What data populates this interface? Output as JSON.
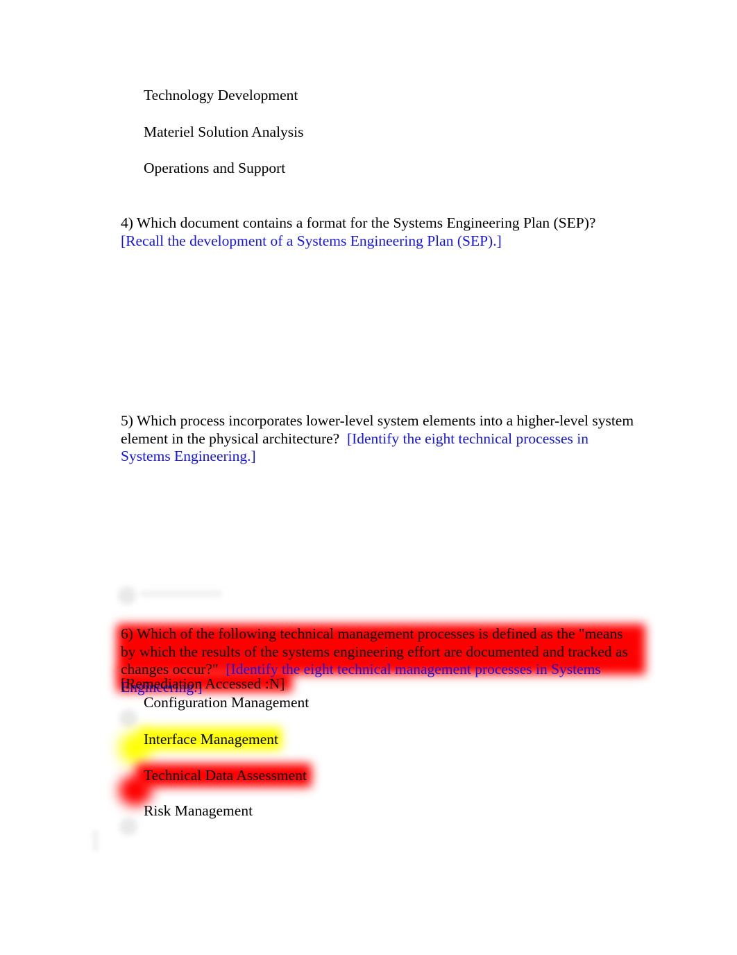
{
  "document": {
    "page_background": "#ffffff",
    "body_text_color": "#000000",
    "link_text_color": "#1414e6",
    "highlight_red": "#ff0000",
    "highlight_yellow": "#ffff00"
  },
  "carryover_options": [
    {
      "label": "Technology Development"
    },
    {
      "label": "Materiel Solution Analysis"
    },
    {
      "label": "Operations and Support"
    }
  ],
  "questions": [
    {
      "number": "4)",
      "stem": "4) Which document contains a format for the Systems Engineering Plan (SEP)?",
      "remediation": "[Recall the development of a Systems Engineering Plan (SEP).]",
      "options": []
    },
    {
      "number": "5)",
      "stem": "5) Which process incorporates lower-level system elements into a higher-level system element in the physical architecture?",
      "remediation": "[Identify the eight technical processes in Systems Engineering.]",
      "options": []
    },
    {
      "number": "6)",
      "stem": "6) Which of the following technical management processes is defined as the \"means by which the results of the systems engineering effort are documented and tracked as changes occur?\"",
      "remediation": "[Identify the eight technical management processes in Systems Engineering.]",
      "remediation_accessed": "[Remediation Accessed :N]",
      "options": [
        {
          "label": "Configuration Management",
          "highlight": "none"
        },
        {
          "label": "Interface Management",
          "highlight": "yellow"
        },
        {
          "label": "Technical Data Assessment",
          "highlight": "red"
        },
        {
          "label": "Risk Management",
          "highlight": "none"
        }
      ]
    }
  ]
}
